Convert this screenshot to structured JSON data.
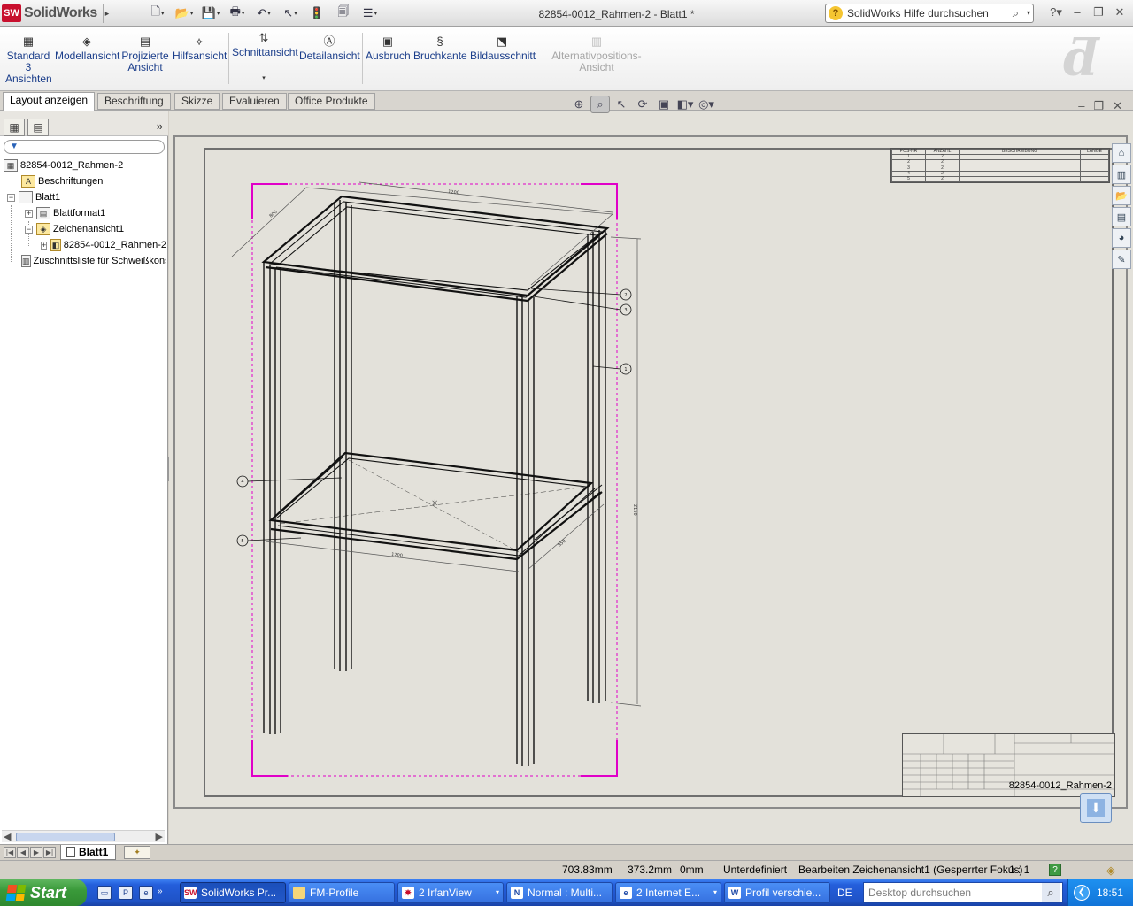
{
  "app": {
    "name": "SolidWorks",
    "logo_badge": "SW",
    "doc_title": "82854-0012_Rahmen-2 - Blatt1 *",
    "help_search_placeholder": "SolidWorks Hilfe durchsuchen"
  },
  "quickbar": {
    "items": [
      {
        "icon": "new-document-icon",
        "glyph": "🗋"
      },
      {
        "icon": "open-folder-icon",
        "glyph": "📂"
      },
      {
        "icon": "save-icon",
        "glyph": "💾"
      },
      {
        "icon": "print-icon",
        "glyph": "🖶"
      },
      {
        "icon": "undo-icon",
        "glyph": "↶"
      },
      {
        "icon": "select-pointer-icon",
        "glyph": "↖"
      },
      {
        "icon": "rebuild-traffic-light-icon",
        "glyph": "🚦"
      },
      {
        "icon": "file-properties-icon",
        "glyph": "🗐"
      },
      {
        "icon": "options-icon",
        "glyph": "☰"
      }
    ]
  },
  "commands": [
    {
      "label": "Standard\n3\nAnsichten",
      "icon": "standard-3-views-icon",
      "glyph": "▦"
    },
    {
      "label": "Modellansicht",
      "icon": "model-view-icon",
      "glyph": "◈"
    },
    {
      "label": "Projizierte\nAnsicht",
      "icon": "projected-view-icon",
      "glyph": "▤"
    },
    {
      "label": "Hilfsansicht",
      "icon": "auxiliary-view-icon",
      "glyph": "⟡"
    },
    {
      "label": "Schnittansicht",
      "icon": "section-view-icon",
      "glyph": "⇅"
    },
    {
      "label": "Detailansicht",
      "icon": "detail-view-icon",
      "glyph": "Ⓐ"
    },
    {
      "label": "Ausbruch",
      "icon": "broken-out-section-icon",
      "glyph": "▣"
    },
    {
      "label": "Bruchkante",
      "icon": "break-icon",
      "glyph": "§"
    },
    {
      "label": "Bildausschnitt",
      "icon": "crop-view-icon",
      "glyph": "⬔"
    },
    {
      "label": "Alternativpositions-Ansicht",
      "icon": "alternate-position-view-icon",
      "glyph": "▥",
      "disabled": true
    }
  ],
  "tabs": [
    "Layout anzeigen",
    "Beschriftung",
    "Skizze",
    "Evaluieren",
    "Office Produkte"
  ],
  "tree": {
    "root": "82854-0012_Rahmen-2",
    "annotations": "Beschriftungen",
    "sheet": "Blatt1",
    "sheet_format": "Blattformat1",
    "drawing_view": "Zeichenansicht1",
    "part": "82854-0012_Rahmen-2",
    "cut_list": "Zuschnittsliste für Schweißkonstruktionen"
  },
  "drawing": {
    "bom_headers": [
      "POS-NR",
      "ANZAHL",
      "BESCHREIBUNG",
      "LÄNGE"
    ],
    "bom_rows": 5,
    "dims": {
      "top_length": "1200",
      "top_depth": "800",
      "height": "2150",
      "bottom_length": "1200",
      "bottom_depth": "850"
    },
    "balloons": [
      "1",
      "2",
      "3",
      "4",
      "5"
    ],
    "title_block_name": "82854-0012_Rahmen-2"
  },
  "sheet_tab": "Blatt1",
  "status": {
    "x": "703.83mm",
    "y": "373.2mm",
    "z": "0mm",
    "state": "Unterdefiniert",
    "edit": "Bearbeiten Zeichenansicht1 (Gesperrter Fokus)",
    "scale": "1 : 1"
  },
  "taskbar": {
    "start": "Start",
    "tasks": [
      {
        "label": "SolidWorks Pr...",
        "icon": "SW",
        "active": true
      },
      {
        "label": "FM-Profile",
        "icon": "📁"
      },
      {
        "label": "2 IrfanView",
        "icon": "✸",
        "group": true
      },
      {
        "label": "Normal : Multi...",
        "icon": "N"
      },
      {
        "label": "2 Internet E...",
        "icon": "e",
        "group": true
      },
      {
        "label": "Profil verschie...",
        "icon": "W"
      }
    ],
    "lang": "DE",
    "search_placeholder": "Desktop durchsuchen",
    "clock": "18:51"
  },
  "colors": {
    "magenta": "#e000c8",
    "sheet_bg": "#e3e1da",
    "accent": "#1a3d8a"
  }
}
